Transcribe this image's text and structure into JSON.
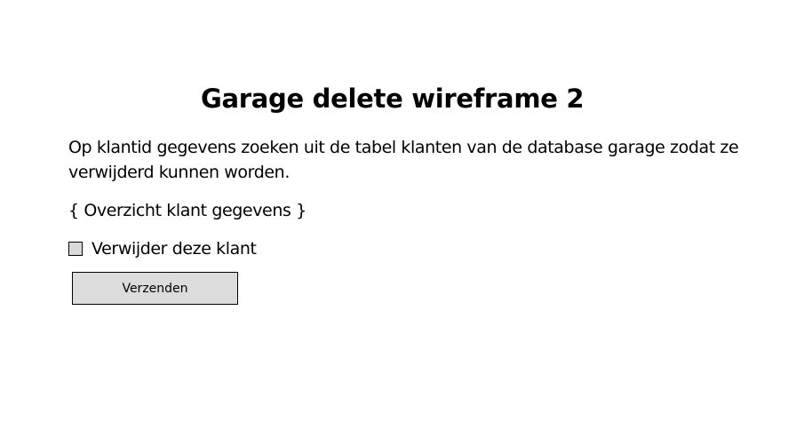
{
  "page": {
    "title": "Garage delete wireframe 2",
    "description": "Op klantid gegevens zoeken uit de tabel klanten van de database garage zodat ze verwijderd kunnen worden.",
    "overview_placeholder": "{ Overzicht klant gegevens }"
  },
  "form": {
    "checkbox_label": "Verwijder deze klant",
    "checkbox_checked": false,
    "submit_label": "Verzenden"
  }
}
